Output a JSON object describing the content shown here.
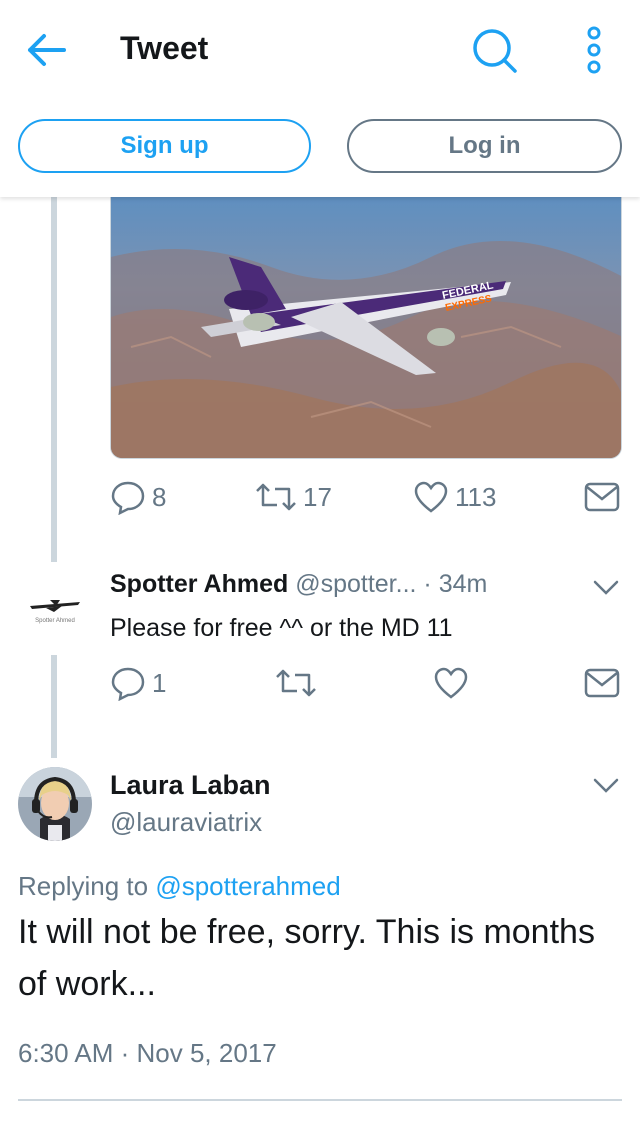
{
  "header": {
    "title": "Tweet",
    "back_icon": "arrow-left-icon",
    "search_icon": "search-icon",
    "more_icon": "more-vertical-icon",
    "accent": "#1da1f2"
  },
  "auth": {
    "signup_label": "Sign up",
    "login_label": "Log in"
  },
  "media_tweet": {
    "image_description_icon": "airplane-photo",
    "actions": {
      "reply_count": "8",
      "retweet_count": "17",
      "like_count": "113"
    }
  },
  "reply": {
    "name": "Spotter Ahmed",
    "handle": "@spotter...",
    "time": "· 34m",
    "avatar_caption": "Spotter Ahmed",
    "text": "Please for free ^^ or the MD 11",
    "actions": {
      "reply_count": "1",
      "retweet_count": "",
      "like_count": ""
    }
  },
  "main_tweet": {
    "name": "Laura Laban",
    "handle": "@lauraviatrix",
    "replying_prefix": "Replying to ",
    "replying_to": "@spotterahmed",
    "text": "It will not be free, sorry. This is months of work...",
    "timestamp": "6:30 AM · Nov 5, 2017"
  }
}
